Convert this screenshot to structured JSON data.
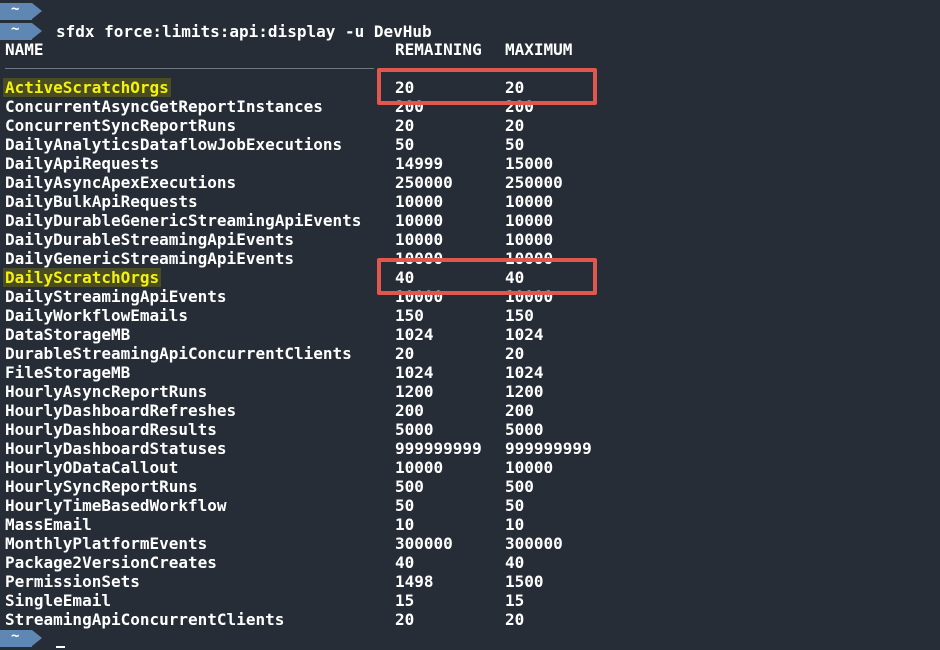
{
  "terminal": {
    "prompt_symbol": "~",
    "command": "sfdx force:limits:api:display -u DevHub",
    "columns": {
      "name": "NAME",
      "remaining": "REMAINING",
      "maximum": "MAXIMUM"
    },
    "rows": [
      {
        "name": "ActiveScratchOrgs",
        "remaining": "20",
        "maximum": "20",
        "highlighted": true
      },
      {
        "name": "ConcurrentAsyncGetReportInstances",
        "remaining": "200",
        "maximum": "200"
      },
      {
        "name": "ConcurrentSyncReportRuns",
        "remaining": "20",
        "maximum": "20"
      },
      {
        "name": "DailyAnalyticsDataflowJobExecutions",
        "remaining": "50",
        "maximum": "50"
      },
      {
        "name": "DailyApiRequests",
        "remaining": "14999",
        "maximum": "15000"
      },
      {
        "name": "DailyAsyncApexExecutions",
        "remaining": "250000",
        "maximum": "250000"
      },
      {
        "name": "DailyBulkApiRequests",
        "remaining": "10000",
        "maximum": "10000"
      },
      {
        "name": "DailyDurableGenericStreamingApiEvents",
        "remaining": "10000",
        "maximum": "10000"
      },
      {
        "name": "DailyDurableStreamingApiEvents",
        "remaining": "10000",
        "maximum": "10000"
      },
      {
        "name": "DailyGenericStreamingApiEvents",
        "remaining": "10000",
        "maximum": "10000"
      },
      {
        "name": "DailyScratchOrgs",
        "remaining": "40",
        "maximum": "40",
        "highlighted": true
      },
      {
        "name": "DailyStreamingApiEvents",
        "remaining": "10000",
        "maximum": "10000"
      },
      {
        "name": "DailyWorkflowEmails",
        "remaining": "150",
        "maximum": "150"
      },
      {
        "name": "DataStorageMB",
        "remaining": "1024",
        "maximum": "1024"
      },
      {
        "name": "DurableStreamingApiConcurrentClients",
        "remaining": "20",
        "maximum": "20"
      },
      {
        "name": "FileStorageMB",
        "remaining": "1024",
        "maximum": "1024"
      },
      {
        "name": "HourlyAsyncReportRuns",
        "remaining": "1200",
        "maximum": "1200"
      },
      {
        "name": "HourlyDashboardRefreshes",
        "remaining": "200",
        "maximum": "200"
      },
      {
        "name": "HourlyDashboardResults",
        "remaining": "5000",
        "maximum": "5000"
      },
      {
        "name": "HourlyDashboardStatuses",
        "remaining": "999999999",
        "maximum": "999999999"
      },
      {
        "name": "HourlyODataCallout",
        "remaining": "10000",
        "maximum": "10000"
      },
      {
        "name": "HourlySyncReportRuns",
        "remaining": "500",
        "maximum": "500"
      },
      {
        "name": "HourlyTimeBasedWorkflow",
        "remaining": "50",
        "maximum": "50"
      },
      {
        "name": "MassEmail",
        "remaining": "10",
        "maximum": "10"
      },
      {
        "name": "MonthlyPlatformEvents",
        "remaining": "300000",
        "maximum": "300000"
      },
      {
        "name": "Package2VersionCreates",
        "remaining": "40",
        "maximum": "40"
      },
      {
        "name": "PermissionSets",
        "remaining": "1498",
        "maximum": "1500"
      },
      {
        "name": "SingleEmail",
        "remaining": "15",
        "maximum": "15"
      },
      {
        "name": "StreamingApiConcurrentClients",
        "remaining": "20",
        "maximum": "20"
      }
    ]
  },
  "colors": {
    "background": "#262d37",
    "prompt_badge": "#5e88b3",
    "highlight_text": "#f4f20b",
    "annotation_box": "#e0574e"
  }
}
